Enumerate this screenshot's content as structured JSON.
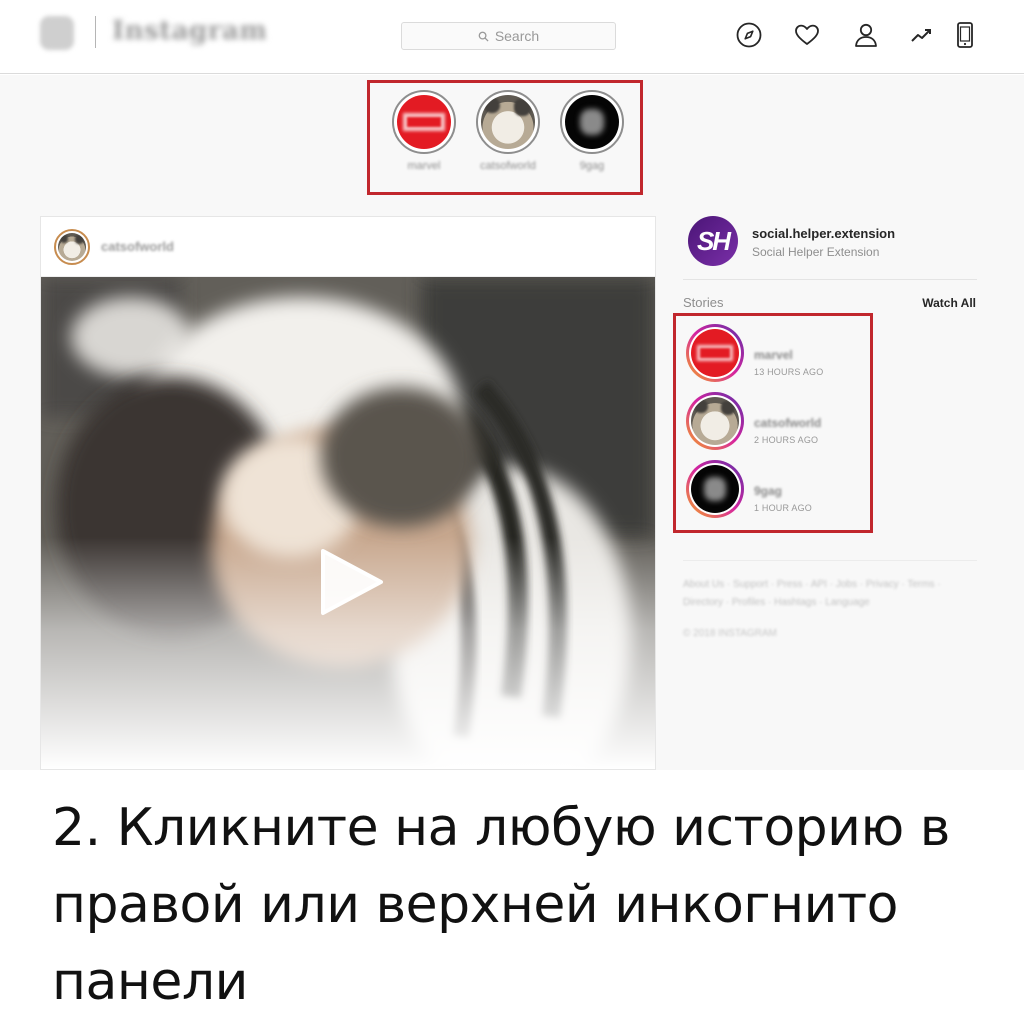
{
  "header": {
    "logo_text": "Instagram",
    "search_placeholder": "Search",
    "icons": [
      "compass-icon",
      "heart-icon",
      "person-icon",
      "trend-icon",
      "phone-icon"
    ]
  },
  "top_stories": [
    {
      "name": "marvel",
      "avatar": "marvel"
    },
    {
      "name": "catsofworld",
      "avatar": "cat"
    },
    {
      "name": "9gag",
      "avatar": "black"
    }
  ],
  "post": {
    "username": "catsofworld"
  },
  "sidebar": {
    "username": "social.helper.extension",
    "full_name": "Social Helper Extension",
    "avatar_text": "SH",
    "stories_title": "Stories",
    "watch_all": "Watch All",
    "stories": [
      {
        "name": "marvel",
        "time": "13 HOURS AGO",
        "avatar": "marvel"
      },
      {
        "name": "catsofworld",
        "time": "2 HOURS AGO",
        "avatar": "cat"
      },
      {
        "name": "9gag",
        "time": "1 HOUR AGO",
        "avatar": "black"
      }
    ],
    "footer_links": "About Us · Support · Press · API · Jobs · Privacy · Terms · Directory · Profiles · Hashtags · Language",
    "copyright": "© 2018 INSTAGRAM"
  },
  "caption": "2. Кликните на любую историю в правой или верхней инкогнито панели",
  "colors": {
    "highlight_border": "#c1272d",
    "marvel_red": "#e31b23",
    "sh_purple": "#4a1576"
  }
}
